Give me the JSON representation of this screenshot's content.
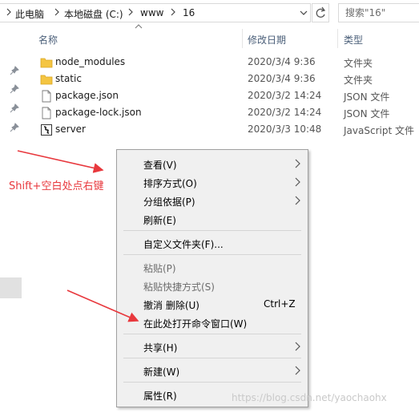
{
  "address_bar": {
    "crumbs": [
      "此电脑",
      "本地磁盘 (C:)",
      "www",
      "16"
    ]
  },
  "search": {
    "placeholder": "搜索\"16\""
  },
  "columns": {
    "name": "名称",
    "date": "修改日期",
    "type": "类型"
  },
  "files": [
    {
      "name": "node_modules",
      "date": "2020/3/4 9:36",
      "type": "文件夹",
      "icon": "folder-icon"
    },
    {
      "name": "static",
      "date": "2020/3/4 9:36",
      "type": "文件夹",
      "icon": "folder-icon"
    },
    {
      "name": "package.json",
      "date": "2020/3/2 14:24",
      "type": "JSON 文件",
      "icon": "document-icon"
    },
    {
      "name": "package-lock.json",
      "date": "2020/3/2 14:24",
      "type": "JSON 文件",
      "icon": "document-icon"
    },
    {
      "name": "server",
      "date": "2020/3/3 10:48",
      "type": "JavaScript 文件",
      "icon": "script-icon"
    }
  ],
  "annotation": {
    "text": "Shift+空白处点右键"
  },
  "context_menu": {
    "view": "查看(V)",
    "sort": "排序方式(O)",
    "group": "分组依据(P)",
    "refresh": "刷新(E)",
    "customize": "自定义文件夹(F)...",
    "paste": "粘贴(P)",
    "paste_shortcut": "粘贴快捷方式(S)",
    "undo_delete": "撤消 删除(U)",
    "undo_shortcut": "Ctrl+Z",
    "open_cmd": "在此处打开命令窗口(W)",
    "share": "共享(H)",
    "new": "新建(W)",
    "properties": "属性(R)"
  },
  "watermark": "https://blog.csdn.net/yaochaohx",
  "colors": {
    "annotation": "#e8383d",
    "header_text": "#4c607a",
    "folder": "#f4c542"
  }
}
